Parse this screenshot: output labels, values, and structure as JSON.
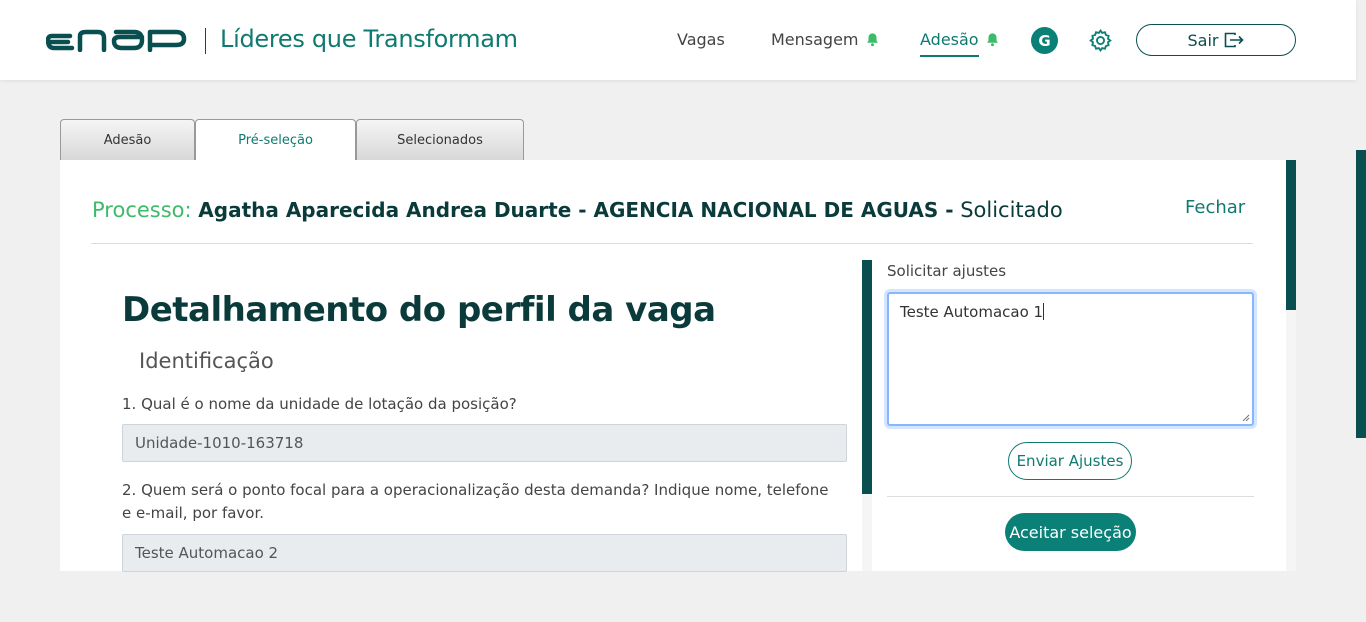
{
  "header": {
    "brand_title": "Líderes que Transformam",
    "nav": {
      "vagas": "Vagas",
      "mensagem": "Mensagem",
      "adesao": "Adesão"
    },
    "avatar_initial": "G",
    "logout_label": "Sair",
    "accent_color": "#0f7a70"
  },
  "tabs": [
    {
      "label": "Adesão"
    },
    {
      "label": "Pré-seleção"
    },
    {
      "label": "Selecionados"
    }
  ],
  "process": {
    "label": "Processo:",
    "name": "Agatha Aparecida Andrea Duarte - AGENCIA NACIONAL DE AGUAS -",
    "status": "Solicitado",
    "close_label": "Fechar"
  },
  "detail": {
    "title": "Detalhamento do perfil da vaga",
    "section": "Identificação",
    "questions": [
      {
        "text": "1. Qual é o nome da unidade de lotação da posição?",
        "value": "Unidade-1010-163718"
      },
      {
        "text": "2. Quem será o ponto focal para a operacionalização desta demanda? Indique nome, telefone e e-mail, por favor.",
        "value": "Teste Automacao 2"
      }
    ]
  },
  "adjust": {
    "label": "Solicitar ajustes",
    "value": "Teste Automacao 1",
    "send_label": "Enviar Ajustes",
    "accept_label": "Aceitar seleção"
  }
}
